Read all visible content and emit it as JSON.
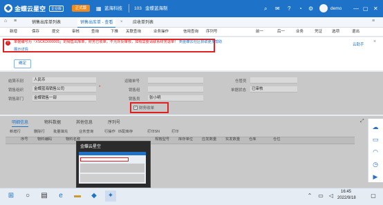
{
  "topbar": {
    "brand": "金蝶云星空",
    "brand_badge": "企业版",
    "trial_button": "正式版",
    "company": "蓝海科技",
    "org_code": "103",
    "org_name": "金蝶蓝海制",
    "user": "demo"
  },
  "tabs": [
    "销售出库单列表",
    "销售出库单 - 查看",
    "应收单列表"
  ],
  "toolbar": [
    "新增",
    "保存",
    "提交",
    "审核",
    "查询",
    "下推",
    "关联查询",
    "业务操作",
    "信用查询",
    "序列号",
    "前一",
    "后一",
    "业务",
    "凭证",
    "选项",
    "退出"
  ],
  "alert": {
    "message": "单据编号为「XSCKD000005」的销售出库单，财务已收单，不允许反审核，如有需要请联系财务退单！",
    "link": "到金蝶云社区获取更多帮助",
    "more": "展示详情",
    "ok_button": "确定",
    "side_link": "云助手",
    "close": "×"
  },
  "form": {
    "currency_label": "结算币别",
    "currency_value": "人民币",
    "org_label": "销售组织",
    "org_value": "金蝶蓝海销售公司",
    "dept_label": "销售部门",
    "dept_value": "金蝶销售一部",
    "ship_label": "运输单号",
    "group_label": "销售组",
    "sales_label": "销售员",
    "sales_value": "张小明",
    "cargo_label": "仓管员",
    "status_label": "单据状态",
    "status_value": "已审核",
    "checkbox_label": "财务收单",
    "checkbox_checked": true
  },
  "detail": {
    "tabs": [
      "明细信息",
      "物料数据",
      "其他信息",
      "序列号"
    ],
    "toolbar": [
      "新增行",
      "删除行",
      "批量填充",
      "业务查询",
      "行操作",
      "匹配库存",
      "打印SN",
      "打印"
    ],
    "headers": [
      "序号",
      "物料编码",
      "物料名称",
      "规格型号",
      "库存单位",
      "应发数量",
      "实发数量",
      "仓库",
      "仓位"
    ]
  },
  "thumbnail": {
    "title": "金蝶云星空"
  },
  "taskbar": {
    "time": "16:45",
    "date": "2022/9/18"
  },
  "colors": {
    "brand_blue": "#1e73c8",
    "error_red": "#e02020",
    "trial_orange": "#f08a1c"
  }
}
